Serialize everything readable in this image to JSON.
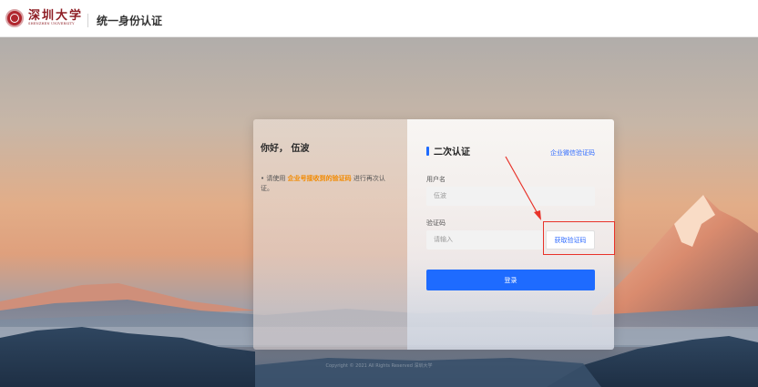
{
  "header": {
    "logo_cn": "深圳大学",
    "logo_en": "SHENZHEN UNIVERSITY",
    "title": "统一身份认证"
  },
  "left_panel": {
    "greeting": "你好， 伍波",
    "notice_prefix": "• 请使用 ",
    "notice_highlight": "企业号接收到的验证码",
    "notice_suffix": " 进行再次认证。"
  },
  "form": {
    "section_title": "二次认证",
    "wechat_link": "企业微信验证码",
    "username_label": "用户名",
    "username_value": "伍波",
    "code_label": "验证码",
    "code_placeholder": "请输入",
    "get_code_button": "获取验证码",
    "login_button": "登录"
  },
  "footer": {
    "copyright": "Copyright © 2021 All Rights Reserved 深圳大学"
  },
  "colors": {
    "accent_blue": "#1e6bff",
    "highlight_orange": "#f28a00",
    "annotation_red": "#e8332a",
    "brand_red": "#8e1e25"
  }
}
